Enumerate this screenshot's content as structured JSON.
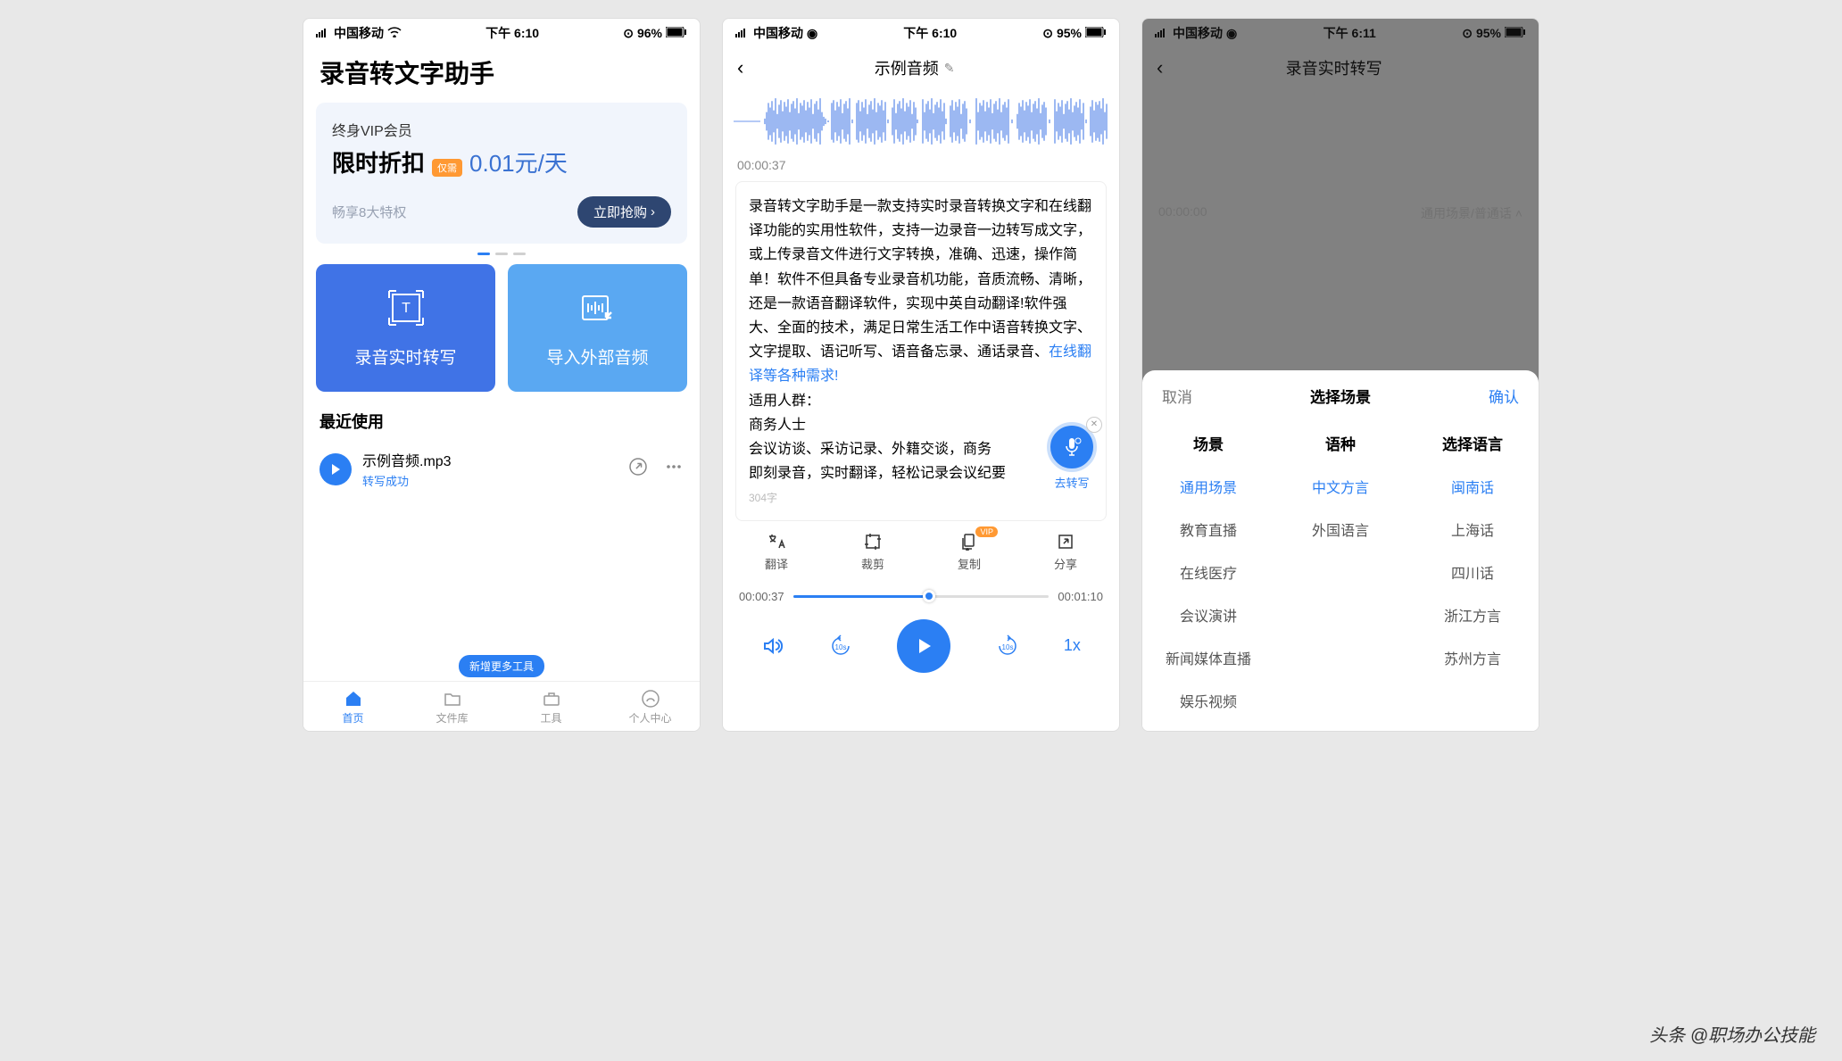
{
  "status": {
    "carrier": "中国移动",
    "time1": "下午 6:10",
    "time3": "下午 6:11",
    "battery1": "96%",
    "battery2": "95%"
  },
  "screen1": {
    "title": "录音转文字助手",
    "promo": {
      "line1": "终身VIP会员",
      "discount": "限时折扣",
      "badge": "仅需",
      "price": "0.01元/天",
      "perks": "畅享8大特权",
      "button": "立即抢购"
    },
    "cards": {
      "left": "录音实时转写",
      "right": "导入外部音频"
    },
    "recent": {
      "header": "最近使用",
      "item_name": "示例音频.mp3",
      "item_status": "转写成功"
    },
    "tool_banner": "新增更多工具",
    "tabs": [
      "首页",
      "文件库",
      "工具",
      "个人中心"
    ]
  },
  "screen2": {
    "title": "示例音频",
    "time": "00:00:37",
    "body1": "录音转文字助手是一款支持实时录音转换文字和在线翻译功能的实用性软件，支持一边录音一边转写成文字，或上传录音文件进行文字转换，准确、迅速，操作简单！软件不但具备专业录音机功能，音质流畅、清晰，还是一款语音翻译软件，实现中英自动翻译!软件强大、全面的技术，满足日常生活工作中语音转换文字、文字提取、语记听写、语音备忘录、通话录音、",
    "body_link": "在线翻译等各种需求!",
    "body2": "适用人群：",
    "body3": "商务人士",
    "body4": "会议访谈、采访记录、外籍交谈，商务",
    "body5": "即刻录音，实时翻译，轻松记录会议纪要",
    "char_count": "304字",
    "fab_label": "去转写",
    "actions": [
      "翻译",
      "裁剪",
      "复制",
      "分享"
    ],
    "vip": "VIP",
    "progress_start": "00:00:37",
    "progress_end": "00:01:10",
    "rewind": "10s",
    "forward": "10s",
    "speed": "1x"
  },
  "screen3": {
    "header": "录音实时转写",
    "time": "00:00:00",
    "scene_lang": "通用场景/普通话",
    "sheet": {
      "cancel": "取消",
      "title": "选择场景",
      "confirm": "确认",
      "cols": [
        "场景",
        "语种",
        "选择语言"
      ],
      "scenes": [
        "通用场景",
        "教育直播",
        "在线医疗",
        "会议演讲",
        "新闻媒体直播",
        "娱乐视频"
      ],
      "langs": [
        "中文方言",
        "外国语言"
      ],
      "dialects": [
        "闽南话",
        "上海话",
        "四川话",
        "浙江方言",
        "苏州方言"
      ]
    }
  },
  "watermark": "头条 @职场办公技能"
}
